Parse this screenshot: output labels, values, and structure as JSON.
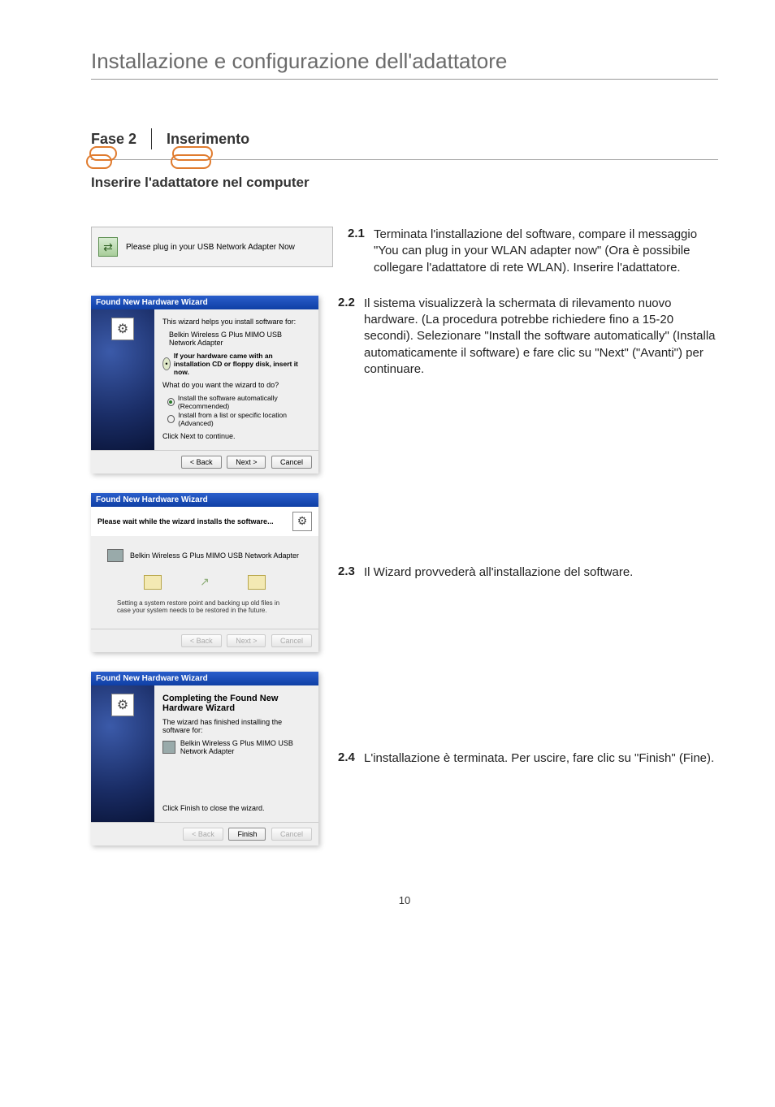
{
  "page_title": "Installazione e configurazione dell'adattatore",
  "phase": {
    "label": "Fase 2",
    "name": "Inserimento"
  },
  "subheading": "Inserire l'adattatore nel computer",
  "plug_msg": "Please plug in your USB Network Adapter Now",
  "wiz_title": "Found New Hardware Wizard",
  "wiz1": {
    "intro": "This wizard helps you install software for:",
    "device": "Belkin Wireless G Plus MIMO USB Network Adapter",
    "tip": "If your hardware came with an installation CD or floppy disk, insert it now.",
    "question": "What do you want the wizard to do?",
    "opt_auto": "Install the software automatically (Recommended)",
    "opt_list": "Install from a list or specific location (Advanced)",
    "click_next": "Click Next to continue."
  },
  "wiz2": {
    "strip": "Please wait while the wizard installs the software...",
    "device": "Belkin Wireless G Plus MIMO USB Network Adapter",
    "note": "Setting a system restore point and backing up old files in case your system needs to be restored in the future."
  },
  "wiz3": {
    "heading": "Completing the Found New Hardware Wizard",
    "line": "The wizard has finished installing the software for:",
    "device": "Belkin Wireless G Plus MIMO USB Network Adapter",
    "close": "Click Finish to close the wizard."
  },
  "buttons": {
    "back": "< Back",
    "next": "Next >",
    "cancel": "Cancel",
    "finish": "Finish"
  },
  "steps": {
    "s1": {
      "num": "2.1",
      "text": "Terminata l'installazione del software, compare il messaggio \"You can plug in your WLAN adapter now\" (Ora è possibile collegare l'adattatore di rete WLAN). Inserire l'adattatore."
    },
    "s2": {
      "num": "2.2",
      "text": "Il sistema visualizzerà la schermata di rilevamento nuovo hardware. (La procedura potrebbe richiedere fino a 15-20 secondi). Selezionare \"Install the software automatically\" (Installa automaticamente il software) e fare clic su \"Next\" (\"Avanti\") per continuare."
    },
    "s3": {
      "num": "2.3",
      "text": "Il Wizard provvederà all'installazione del software."
    },
    "s4": {
      "num": "2.4",
      "text": "L'installazione è terminata. Per uscire, fare clic su \"Finish\" (Fine)."
    }
  },
  "page_number": "10"
}
